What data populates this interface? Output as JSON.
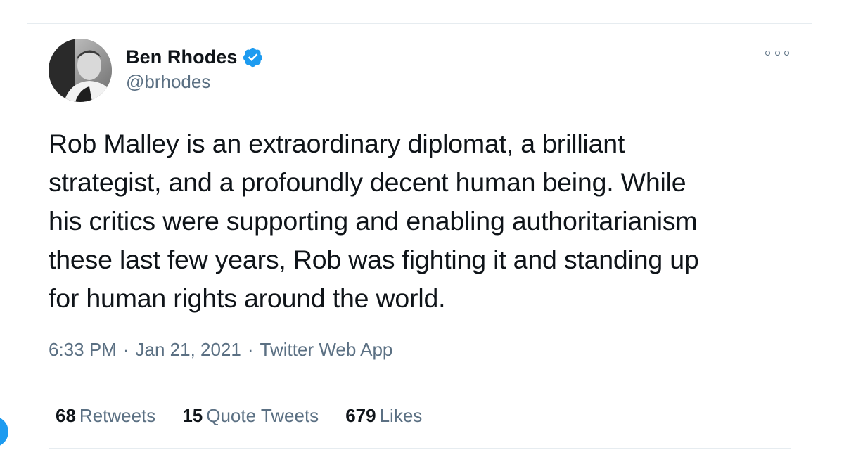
{
  "author": {
    "name": "Ben Rhodes",
    "handle": "@brhodes",
    "verified": true,
    "verified_color": "#1d9bf0"
  },
  "tweet": {
    "text": "Rob Malley is an extraordinary diplomat, a brilliant\nstrategist, and a profoundly decent human being. While\nhis critics were supporting and enabling authoritarianism\nthese last few years, Rob was fighting it and standing up\nfor human rights around the world."
  },
  "meta": {
    "time": "6:33 PM",
    "separator": "·",
    "date": "Jan 21, 2021",
    "source": "Twitter Web App"
  },
  "stats": {
    "retweets": {
      "count": "68",
      "label": "Retweets"
    },
    "quote_tweets": {
      "count": "15",
      "label": "Quote Tweets"
    },
    "likes": {
      "count": "679",
      "label": "Likes"
    }
  },
  "icons": {
    "more": "more-options-icon",
    "verified": "verified-badge-icon"
  },
  "colors": {
    "text_primary": "#0f1419",
    "text_secondary": "#5b7083",
    "divider": "#e6ecf0",
    "accent": "#1d9bf0"
  }
}
